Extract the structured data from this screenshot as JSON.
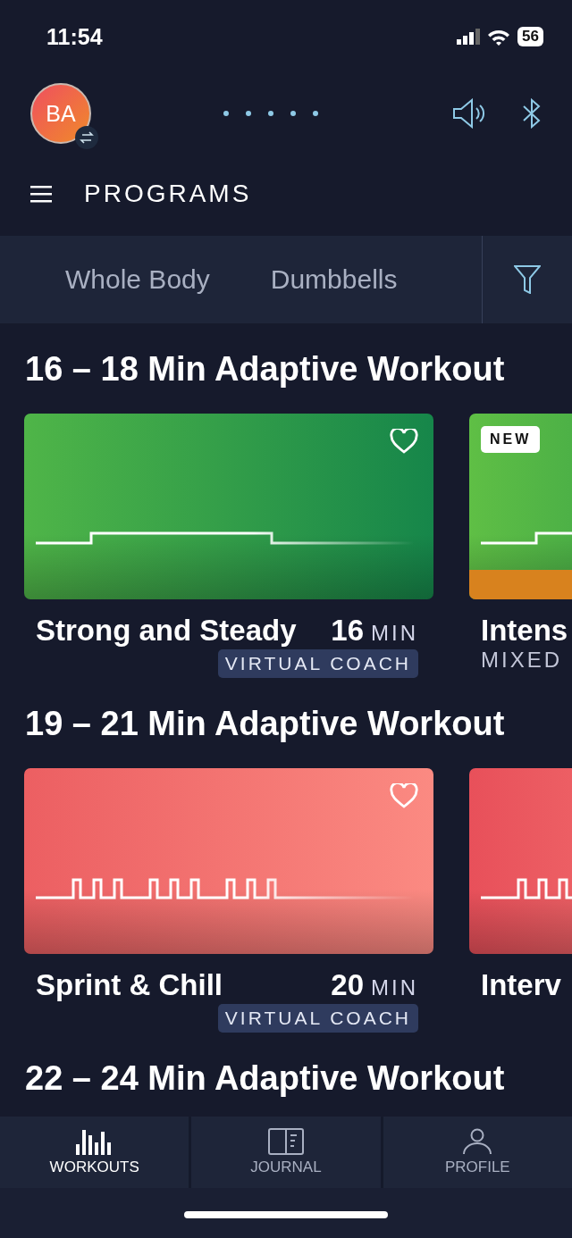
{
  "status_bar": {
    "time": "11:54",
    "battery": "56"
  },
  "header": {
    "avatar_initials": "BA"
  },
  "nav": {
    "title": "PROGRAMS"
  },
  "filters": [
    {
      "label": "Whole Body"
    },
    {
      "label": "Dumbbells"
    }
  ],
  "sections": [
    {
      "title": "16 – 18 Min Adaptive Workout",
      "workouts": [
        {
          "title": "Strong and Steady",
          "duration": "16",
          "unit": "MIN",
          "tag": "VIRTUAL COACH",
          "favorite": false,
          "color": "#4fb548",
          "kind": "steady"
        },
        {
          "title": "Intens",
          "subtitle": "MIXED",
          "badge": "NEW",
          "color": "#5fbf45",
          "strip": {
            "color": "#d8821e"
          },
          "kind": "steady"
        }
      ]
    },
    {
      "title": "19 – 21 Min Adaptive Workout",
      "workouts": [
        {
          "title": "Sprint & Chill",
          "duration": "20",
          "unit": "MIN",
          "tag": "VIRTUAL COACH",
          "favorite": false,
          "color": "#ec5f62",
          "kind": "intervals"
        },
        {
          "title": "Interv",
          "color": "#e8505a",
          "kind": "intervals"
        }
      ]
    },
    {
      "title": "22 – 24 Min Adaptive Workout"
    }
  ],
  "tabs": [
    {
      "label": "WORKOUTS",
      "selected": true,
      "kind": "bars"
    },
    {
      "label": "JOURNAL",
      "selected": false,
      "kind": "book"
    },
    {
      "label": "PROFILE",
      "selected": false,
      "kind": "person"
    }
  ]
}
